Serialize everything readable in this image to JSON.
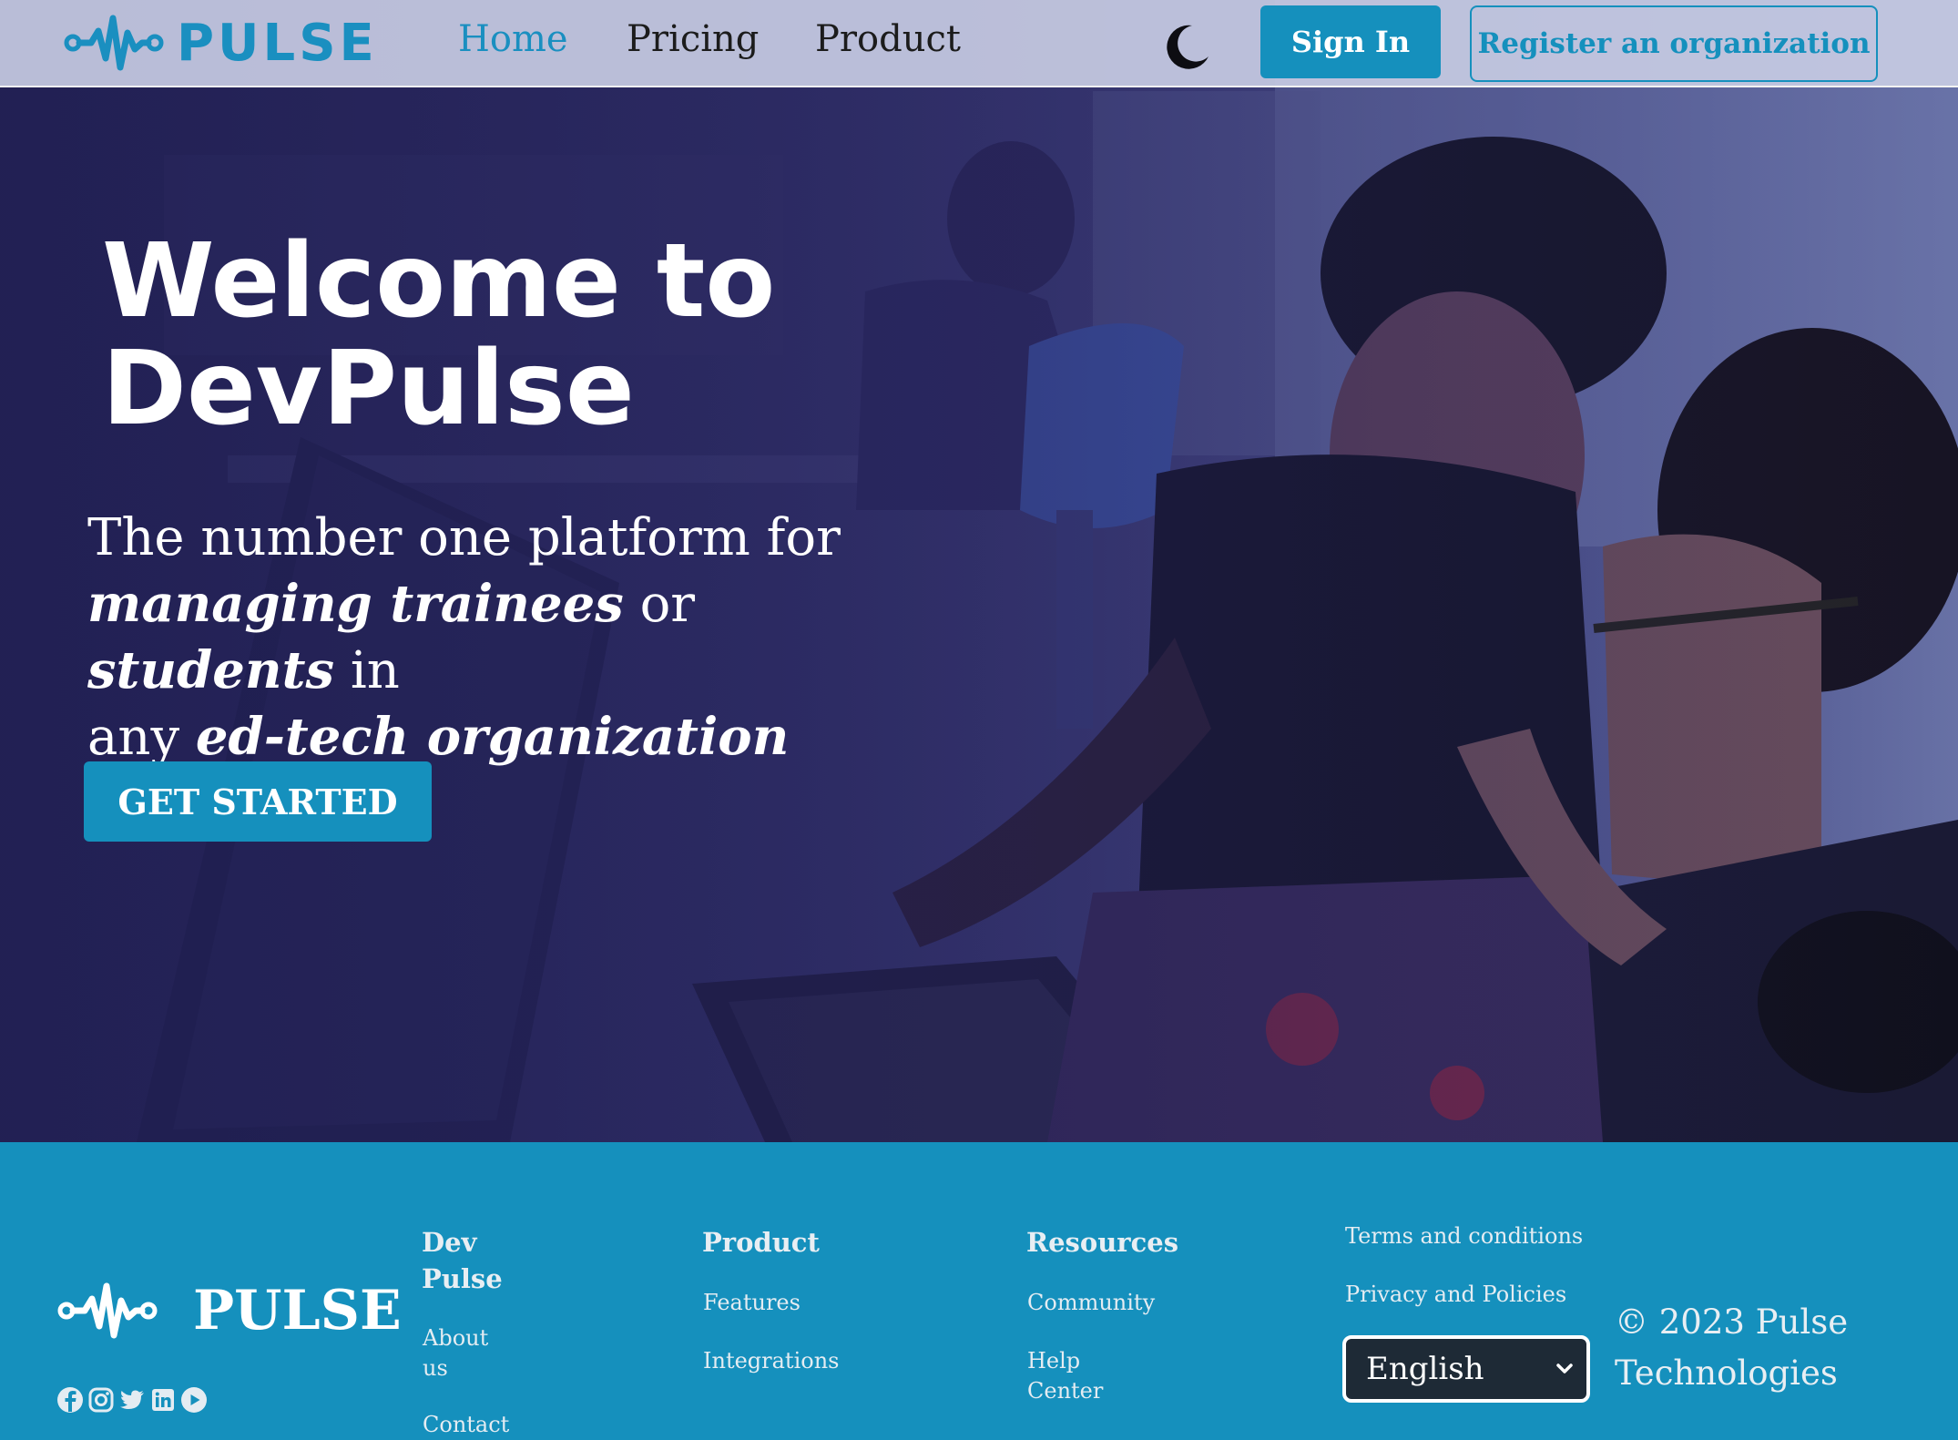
{
  "brand": {
    "name": "PULSE",
    "accent": "#1590bd"
  },
  "nav": {
    "links": [
      "Home",
      "Pricing",
      "Product"
    ],
    "active": "Home",
    "theme_toggle_icon": "moon-icon",
    "sign_in_label": "Sign In",
    "register_label": "Register an organization"
  },
  "hero": {
    "title_line1": "Welcome to",
    "title_line2": "DevPulse",
    "sub_part1": "The number one platform for",
    "sub_em1": "managing trainees",
    "sub_part2": "or",
    "sub_em2": "students",
    "sub_part3": "in",
    "sub_part4": "any",
    "sub_em3": "ed-tech organization",
    "cta_label": "GET STARTED"
  },
  "footer": {
    "brand": "PULSE",
    "social_icons": [
      "facebook-icon",
      "instagram-icon",
      "twitter-icon",
      "linkedin-icon",
      "youtube-icon"
    ],
    "col1": {
      "heading_line1": "Dev",
      "heading_line2": "Pulse",
      "about_line1": "About",
      "about_line2": "us",
      "contact": "Contact"
    },
    "col2": {
      "heading": "Product",
      "links": [
        "Features",
        "Integrations"
      ]
    },
    "col3": {
      "heading": "Resources",
      "community": "Community",
      "help_line1": "Help",
      "help_line2": "Center"
    },
    "legal": {
      "terms": "Terms and conditions",
      "privacy": "Privacy and Policies"
    },
    "language": {
      "selected": "English"
    },
    "copyright_line1": "© 2023 Pulse",
    "copyright_line2": "Technologies"
  }
}
